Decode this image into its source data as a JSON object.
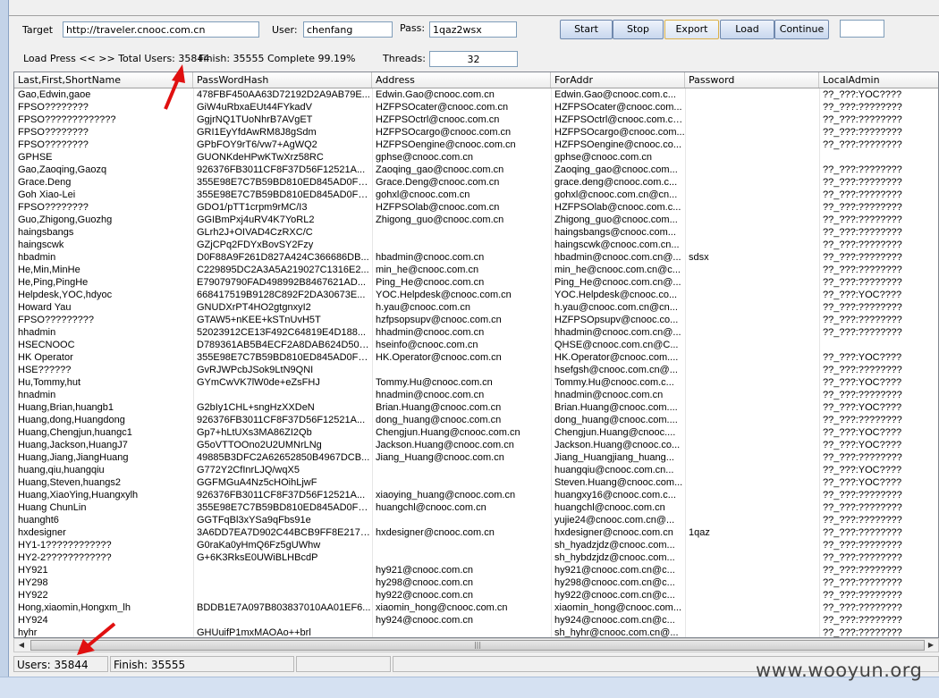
{
  "toolbar": {
    "target_label": "Target",
    "target_value": "http://traveler.cnooc.com.cn",
    "user_label": "User:",
    "user_value": "chenfang",
    "pass_label": "Pass:",
    "pass_value": "1qaz2wsx",
    "buttons": {
      "start": "Start",
      "stop": "Stop",
      "export": "Export",
      "load": "Load",
      "continue": "Continue"
    },
    "extra_value": "",
    "load_press_text": "Load Press << >> Total Users: 35844",
    "finish_text": "Finish: 35555  Complete 99.19%",
    "threads_label": "Threads:",
    "threads_value": "32"
  },
  "grid": {
    "columns": [
      "Last,First,ShortName",
      "PassWordHash",
      "Address",
      "ForAddr",
      "Password",
      "LocalAdmin"
    ],
    "rows": [
      [
        "Gao,Edwin,gaoe",
        "478FBF450AA63D72192D2A9AB79E...",
        "Edwin.Gao@cnooc.com.cn",
        "Edwin.Gao@cnooc.com.c...",
        "",
        "??_???:YOC????"
      ],
      [
        "FPSO????????",
        "GiW4uRbxaEUt44FYkadV",
        "HZFPSOcater@cnooc.com.cn",
        "HZFPSOcater@cnooc.com...",
        "",
        "??_???:????????"
      ],
      [
        "FPSO?????????????",
        "GgjrNQ1TUoNhrB7AVgET",
        "HZFPSOctrl@cnooc.com.cn",
        "HZFPSOctrl@cnooc.com.cn...",
        "",
        "??_???:????????"
      ],
      [
        "FPSO????????",
        "GRI1EyYfdAwRM8J8gSdm",
        "HZFPSOcargo@cnooc.com.cn",
        "HZFPSOcargo@cnooc.com...",
        "",
        "??_???:????????"
      ],
      [
        "FPSO????????",
        "GPbFOY9rT6/vw7+AgWQ2",
        "HZFPSOengine@cnooc.com.cn",
        "HZFPSOengine@cnooc.co...",
        "",
        "??_???:????????"
      ],
      [
        "GPHSE",
        "GUONKdeHPwKTwXrz58RC",
        "gphse@cnooc.com.cn",
        "gphse@cnooc.com.cn",
        "",
        ""
      ],
      [
        "Gao,Zaoqing,Gaozq",
        "926376FB3011CF8F37D56F12521A...",
        "Zaoqing_gao@cnooc.com.cn",
        "Zaoqing_gao@cnooc.com...",
        "",
        "??_???:????????"
      ],
      [
        "Grace.Deng",
        "355E98E7C7B59BD810ED845AD0FD...",
        "Grace.Deng@cnooc.com.cn",
        "grace.deng@cnooc.com.c...",
        "",
        "??_???:????????"
      ],
      [
        "Goh Xiao-Lei",
        "355E98E7C7B59BD810ED845AD0FD...",
        "gohxl@cnooc.com.cn",
        "gohxl@cnooc.com.cn@cn...",
        "",
        "??_???:????????"
      ],
      [
        "FPSO????????",
        "GDO1/pTT1crpm9rMC/I3",
        "HZFPSOlab@cnooc.com.cn",
        "HZFPSOlab@cnooc.com.c...",
        "",
        "??_???:????????"
      ],
      [
        "Guo,Zhigong,Guozhg",
        "GGIBmPxj4uRV4K7YoRL2",
        "Zhigong_guo@cnooc.com.cn",
        "Zhigong_guo@cnooc.com...",
        "",
        "??_???:????????"
      ],
      [
        "haingsbangs",
        "GLrh2J+OIVAD4CzRXC/C",
        "",
        "haingsbangs@cnooc.com...",
        "",
        "??_???:????????"
      ],
      [
        "haingscwk",
        "GZjCPq2FDYxBovSY2Fzy",
        "",
        "haingscwk@cnooc.com.cn...",
        "",
        "??_???:????????"
      ],
      [
        "hbadmin",
        "D0F88A9F261D827A424C366686DB...",
        "hbadmin@cnooc.com.cn",
        "hbadmin@cnooc.com.cn@...",
        "sdsx",
        "??_???:????????"
      ],
      [
        "He,Min,MinHe",
        "C229895DC2A3A5A219027C1316E2...",
        "min_he@cnooc.com.cn",
        "min_he@cnooc.com.cn@c...",
        "",
        "??_???:????????"
      ],
      [
        "He,Ping,PingHe",
        "E79079790FAD498992B8467621AD...",
        "Ping_He@cnooc.com.cn",
        "Ping_He@cnooc.com.cn@...",
        "",
        "??_???:????????"
      ],
      [
        "Helpdesk,YOC,hdyoc",
        "668417519B9128C892F2DA30673E...",
        "YOC.Helpdesk@cnooc.com.cn",
        "YOC.Helpdesk@cnooc.co...",
        "",
        "??_???:YOC????"
      ],
      [
        "Howard Yau",
        "GNUDXrPT4HO2gtgnxyI2",
        "h.yau@cnooc.com.cn",
        "h.yau@cnooc.com.cn@cn...",
        "",
        "??_???:????????"
      ],
      [
        "FPSO?????????",
        "GTAW5+nKEE+kSTnUvH5T",
        "hzfpsopsupv@cnooc.com.cn",
        "HZFPSOpsupv@cnooc.co...",
        "",
        "??_???:????????"
      ],
      [
        "hhadmin",
        "52023912CE13F492C64819E4D188...",
        "hhadmin@cnooc.com.cn",
        "hhadmin@cnooc.com.cn@...",
        "",
        "??_???:????????"
      ],
      [
        "HSECNOOC",
        "D789361AB5B4ECF2A8DAB624D504...",
        "hseinfo@cnooc.com.cn",
        "QHSE@cnooc.com.cn@C...",
        "",
        ""
      ],
      [
        "HK Operator",
        "355E98E7C7B59BD810ED845AD0FD...",
        "HK.Operator@cnooc.com.cn",
        "HK.Operator@cnooc.com....",
        "",
        "??_???:YOC????"
      ],
      [
        "HSE??????",
        "GvRJWPcbJSok9LtN9QNI",
        "",
        "hsefgsh@cnooc.com.cn@...",
        "",
        "??_???:????????"
      ],
      [
        "Hu,Tommy,hut",
        "GYmCwVK7lW0de+eZsFHJ",
        "Tommy.Hu@cnooc.com.cn",
        "Tommy.Hu@cnooc.com.c...",
        "",
        "??_???:YOC????"
      ],
      [
        "hnadmin",
        "",
        "hnadmin@cnooc.com.cn",
        "hnadmin@cnooc.com.cn",
        "",
        "??_???:????????"
      ],
      [
        "Huang,Brian,huangb1",
        "G2bIy1CHL+sngHzXXDeN",
        "Brian.Huang@cnooc.com.cn",
        "Brian.Huang@cnooc.com....",
        "",
        "??_???:YOC????"
      ],
      [
        "Huang,dong,Huangdong",
        "926376FB3011CF8F37D56F12521A...",
        "dong_huang@cnooc.com.cn",
        "dong_huang@cnooc.com....",
        "",
        "??_???:????????"
      ],
      [
        "Huang,Chengjun,huangc1",
        "Gp7+hLtUXs3MA86ZI2Qb",
        "Chengjun.Huang@cnooc.com.cn",
        "Chengjun.Huang@cnooc....",
        "",
        "??_???:YOC????"
      ],
      [
        "Huang,Jackson,HuangJ7",
        "G5oVTTOOno2U2UMNrLNg",
        "Jackson.Huang@cnooc.com.cn",
        "Jackson.Huang@cnooc.co...",
        "",
        "??_???:YOC????"
      ],
      [
        "Huang,Jiang,JiangHuang",
        "49885B3DFC2A62652850B4967DCB...",
        "Jiang_Huang@cnooc.com.cn",
        "Jiang_Huangjiang_huang...",
        "",
        "??_???:????????"
      ],
      [
        "huang,qiu,huangqiu",
        "G772Y2CfInrLJQ/wqX5",
        "",
        "huangqiu@cnooc.com.cn...",
        "",
        "??_???:YOC????"
      ],
      [
        "Huang,Steven,huangs2",
        "GGFMGuA4Nz5cHOihLjwF",
        "",
        "Steven.Huang@cnooc.com...",
        "",
        "??_???:YOC????"
      ],
      [
        "Huang,XiaoYing,Huangxylh",
        "926376FB3011CF8F37D56F12521A...",
        "xiaoying_huang@cnooc.com.cn",
        "huangxy16@cnooc.com.c...",
        "",
        "??_???:????????"
      ],
      [
        "Huang ChunLin",
        "355E98E7C7B59BD810ED845AD0FD...",
        "huangchl@cnooc.com.cn",
        "huangchl@cnooc.com.cn",
        "",
        "??_???:????????"
      ],
      [
        "huanght6",
        "GGTFqBl3xYSa9qFbs91e",
        "",
        "yujie24@cnooc.com.cn@...",
        "",
        "??_???:????????"
      ],
      [
        "hxdesigner",
        "3A6DD7EA7D902C44BCB9FF8E217C...",
        "hxdesigner@cnooc.com.cn",
        "hxdesigner@cnooc.com.cn",
        "1qaz",
        "??_???:????????"
      ],
      [
        "HY1-1????????????",
        "G0raKa0yHmQ6Fz5gUWhw",
        "",
        "sh_hyadzjdz@cnooc.com...",
        "",
        "??_???:????????"
      ],
      [
        "HY2-2????????????",
        "G+6K3RksE0UWiBLHBcdP",
        "",
        "sh_hybdzjdz@cnooc.com...",
        "",
        "??_???:????????"
      ],
      [
        "HY921",
        "",
        "hy921@cnooc.com.cn",
        "hy921@cnooc.com.cn@c...",
        "",
        "??_???:????????"
      ],
      [
        "HY298",
        "",
        "hy298@cnooc.com.cn",
        "hy298@cnooc.com.cn@c...",
        "",
        "??_???:????????"
      ],
      [
        "HY922",
        "",
        "hy922@cnooc.com.cn",
        "hy922@cnooc.com.cn@c...",
        "",
        "??_???:????????"
      ],
      [
        "Hong,xiaomin,Hongxm_lh",
        "BDDB1E7A097B803837010AA01EF6...",
        "xiaomin_hong@cnooc.com.cn",
        "xiaomin_hong@cnooc.com...",
        "",
        "??_???:????????"
      ],
      [
        "HY924",
        "",
        "hy924@cnooc.com.cn",
        "hy924@cnooc.com.cn@c...",
        "",
        "??_???:????????"
      ],
      [
        "hyhr",
        "GHUuifP1mxMAOAo++brl",
        "",
        "sh_hyhr@cnooc.com.cn@...",
        "",
        "??_???:????????"
      ]
    ]
  },
  "scrollbar": {
    "thumb_grip": "|||"
  },
  "status": {
    "users": "Users: 35844",
    "finish": "Finish: 35555"
  },
  "watermark": "www.wooyun.org",
  "colors": {
    "annotation_arrow": "#e01010",
    "button_border": "#6f88ad",
    "export_border": "#d9b04a"
  }
}
